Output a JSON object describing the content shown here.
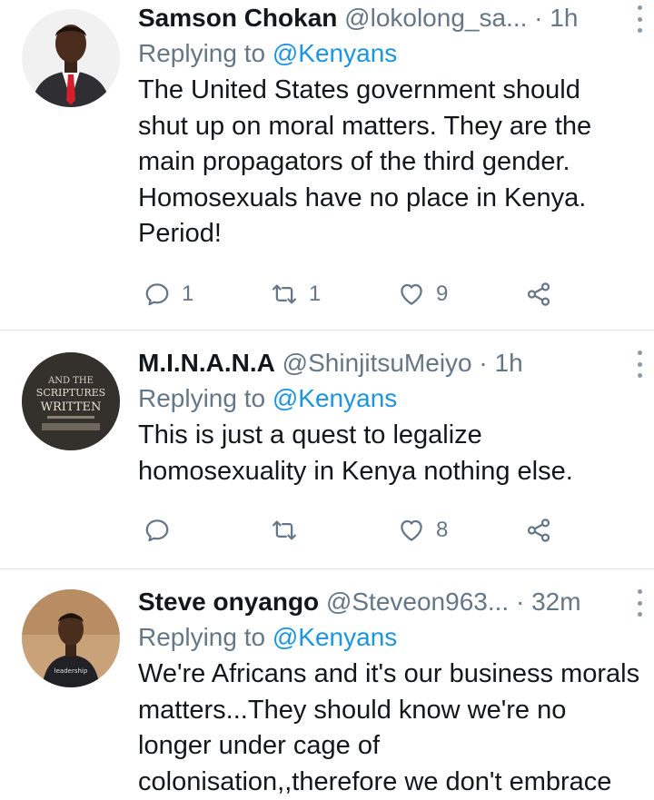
{
  "tweets": [
    {
      "name": "Samson Chokan",
      "handle": "@lokolong_sa...",
      "sep": "·",
      "time": "1h",
      "replying_prefix": "Replying to",
      "replying_to": "@Kenyans",
      "text": "The United States government should shut up on moral matters. They are the main propagators of the third gender. Homosexuals have no place in Kenya. Period!",
      "replies": "1",
      "retweets": "1",
      "likes": "9",
      "avatar": "man-in-suit-red-tie"
    },
    {
      "name": "M.I.N.A.N.A",
      "handle": "@ShinjitsuMeiyo",
      "sep": "·",
      "time": "1h",
      "replying_prefix": "Replying to",
      "replying_to": "@Kenyans",
      "text": "This is just a quest to legalize homosexuality in Kenya nothing else.",
      "replies": "",
      "retweets": "",
      "likes": "8",
      "avatar": "book-cover-text",
      "avatar_text": [
        "AND THE",
        "SCRIPTURES",
        "WRITTEN"
      ]
    },
    {
      "name": "Steve onyango",
      "handle": "@Steveon963...",
      "sep": "·",
      "time": "32m",
      "replying_prefix": "Replying to",
      "replying_to": "@Kenyans",
      "text": "We're Africans and it's our business morals matters...They should know we're no longer under cage of colonisation,,therefore we don't embrace",
      "avatar": "man-in-black-tshirt"
    }
  ],
  "colors": {
    "name": "#14171a",
    "secondary": "#657786",
    "link": "#1b95e0",
    "divider": "#dfe3e6"
  },
  "icons": {
    "reply": "reply-icon",
    "retweet": "retweet-icon",
    "like": "heart-icon",
    "share": "share-icon",
    "more": "more-vertical-icon"
  }
}
